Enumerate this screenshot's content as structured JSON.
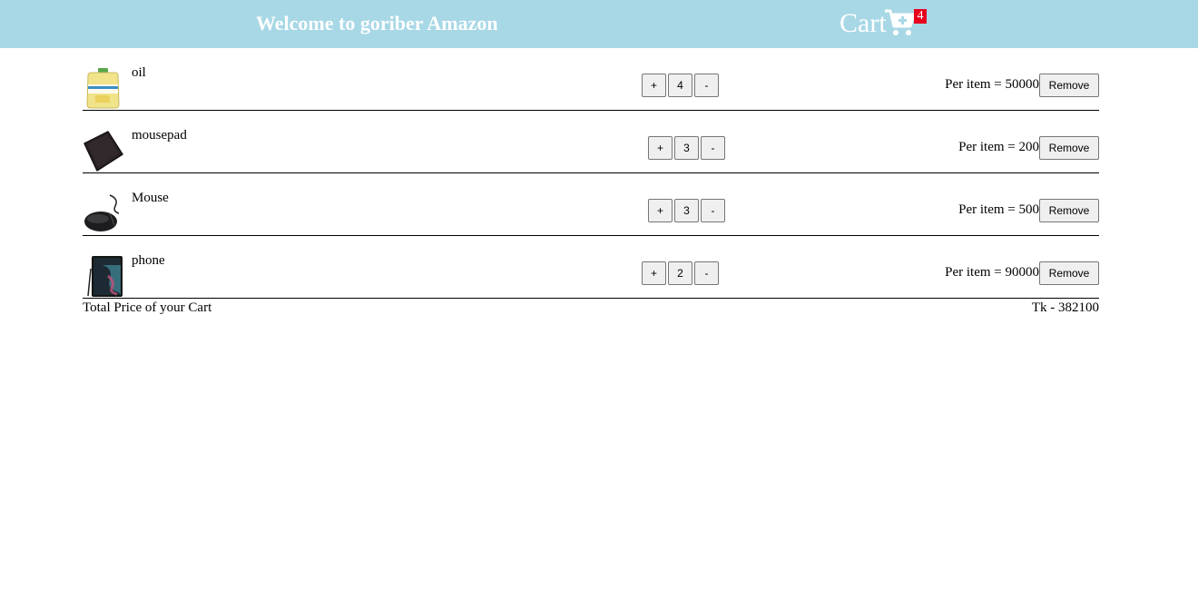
{
  "header": {
    "title": "Welcome to goriber Amazon",
    "cart_label": "Cart",
    "cart_icon": "shopping-cart-plus-icon",
    "cart_count": "4"
  },
  "colors": {
    "header_bg": "#a8d8e6",
    "badge_bg": "#e8001c",
    "header_text": "#ffffff"
  },
  "cart": {
    "items": [
      {
        "name": "oil",
        "quantity": "4",
        "price_text": "Per item = 50000",
        "thumbnail": "oil-bottle-image"
      },
      {
        "name": "mousepad",
        "quantity": "3",
        "price_text": "Per item = 200",
        "thumbnail": "mousepad-image"
      },
      {
        "name": "Mouse",
        "quantity": "3",
        "price_text": "Per item = 500",
        "thumbnail": "mouse-image"
      },
      {
        "name": "phone",
        "quantity": "2",
        "price_text": "Per item = 90000",
        "thumbnail": "phone-image"
      }
    ],
    "plus_label": "+",
    "minus_label": "-",
    "remove_label": "Remove",
    "total_label": "Total Price of your Cart",
    "total_value": "Tk - 382100"
  }
}
